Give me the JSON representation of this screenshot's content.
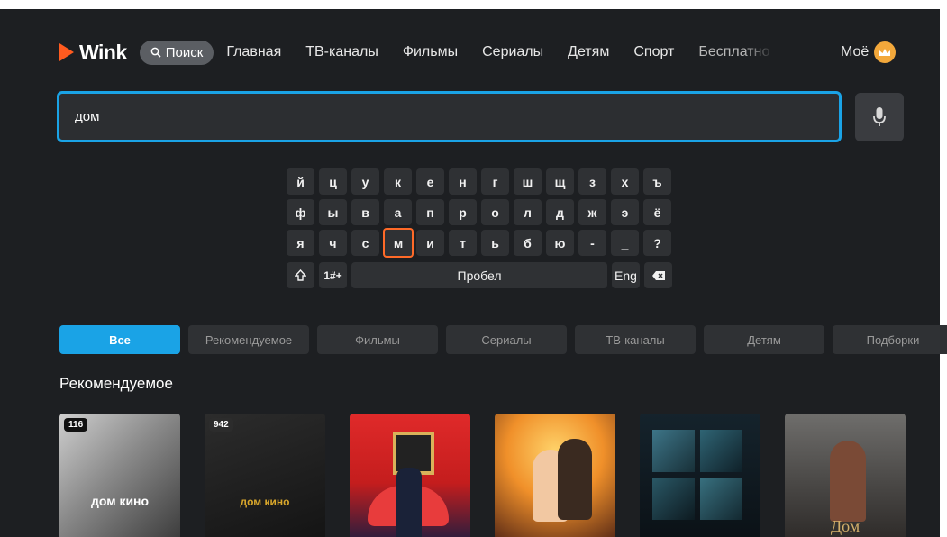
{
  "app": {
    "logo_text": "Wink",
    "colors": {
      "accent": "#1aa3e6",
      "brand": "#ff5b1f",
      "selected_key": "#ff6a28",
      "crown": "#f3a83b"
    }
  },
  "header": {
    "search_label": "Поиск",
    "nav": [
      "Главная",
      "ТВ-каналы",
      "Фильмы",
      "Сериалы",
      "Детям",
      "Спорт"
    ],
    "faded_item": "Бесплатно",
    "mine": "Моё"
  },
  "search": {
    "query": "дом",
    "mic_icon": "microphone-icon"
  },
  "keyboard": {
    "rows": [
      [
        "й",
        "ц",
        "у",
        "к",
        "е",
        "н",
        "г",
        "ш",
        "щ",
        "з",
        "х",
        "ъ"
      ],
      [
        "ф",
        "ы",
        "в",
        "а",
        "п",
        "р",
        "о",
        "л",
        "д",
        "ж",
        "э",
        "ё"
      ],
      [
        "я",
        "ч",
        "с",
        "м",
        "и",
        "т",
        "ь",
        "б",
        "ю",
        "-",
        "_",
        "?"
      ]
    ],
    "selected": "м",
    "shift_icon": "shift-icon",
    "symbols": "1#+",
    "space": "Пробел",
    "lang": "Eng",
    "backspace_icon": "backspace-icon"
  },
  "filters": {
    "tabs": [
      "Все",
      "Рекомендуемое",
      "Фильмы",
      "Сериалы",
      "ТВ-каналы",
      "Детям",
      "Подборки"
    ],
    "active": "Все"
  },
  "section_title": "Рекомендуемое",
  "cards": [
    {
      "badge": "116",
      "label": "дом кино",
      "kind": "channel"
    },
    {
      "badge": "942",
      "label": "дом кино",
      "kind": "channel-premium"
    },
    {
      "kind": "poster"
    },
    {
      "kind": "poster"
    },
    {
      "kind": "poster"
    },
    {
      "kind": "poster",
      "caption": "Дом"
    }
  ]
}
